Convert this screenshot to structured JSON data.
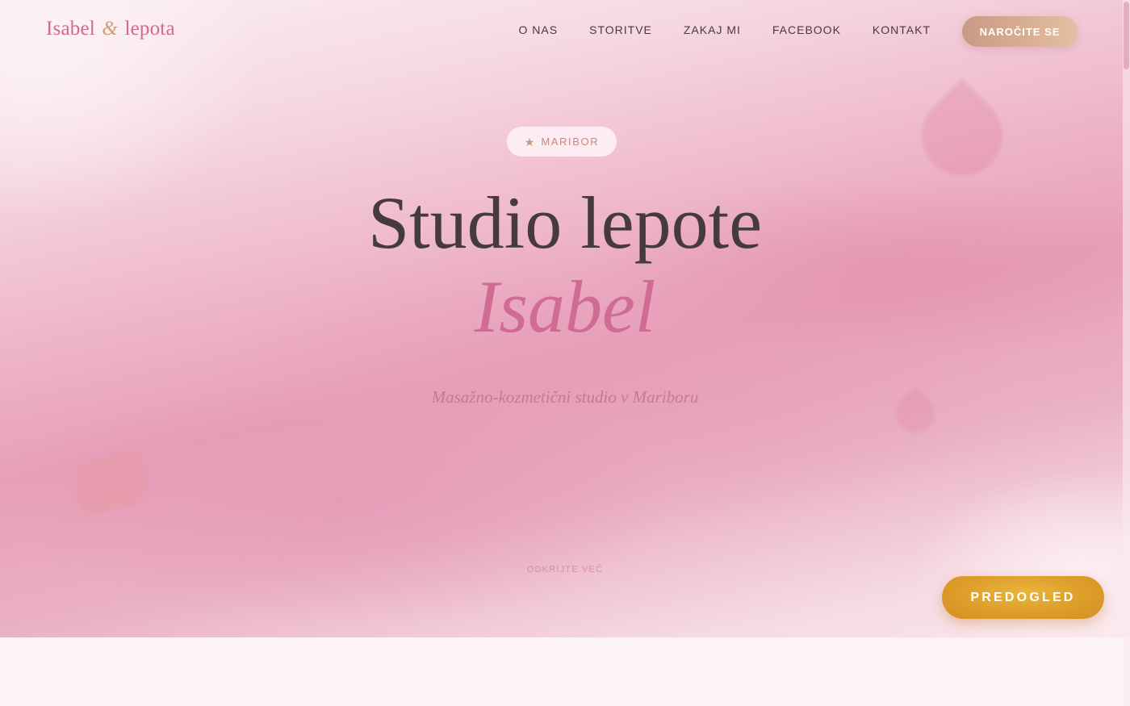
{
  "brand": {
    "name_part1": "Isabel",
    "ampersand": "&",
    "name_part2": "lepota"
  },
  "nav": {
    "items": [
      {
        "label": "O NAS"
      },
      {
        "label": "STORITVE"
      },
      {
        "label": "ZAKAJ MI"
      },
      {
        "label": "FACEBOOK"
      },
      {
        "label": "KONTAKT"
      }
    ],
    "cta_label": "NAROČITE SE"
  },
  "hero": {
    "badge": {
      "icon": "star-icon",
      "label": "MARIBOR"
    },
    "title_line1": "Studio lepote",
    "title_line2": "Isabel",
    "subtitle": "Masažno-kozmetični studio v Mariboru",
    "scroll_label": "ODKRIJTE VEČ"
  },
  "floating_button": {
    "label": "PREDOGLED"
  },
  "colors": {
    "accent_pink": "#d06b93",
    "gold_cta": "#dc9c28",
    "nav_cta": "#d8ae93",
    "title_dark": "#453a3f"
  }
}
